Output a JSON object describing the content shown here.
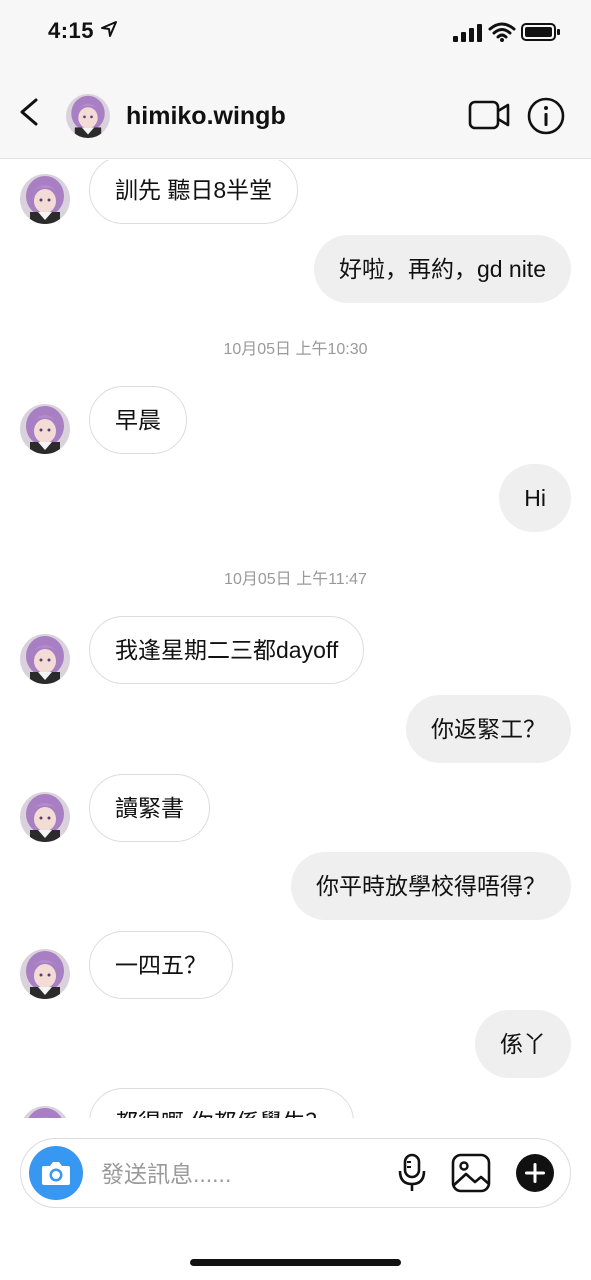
{
  "status_bar": {
    "time": "4:15"
  },
  "header": {
    "username": "himiko.wingb"
  },
  "messages": [
    {
      "from": "them",
      "text": "訓先 聽日8半堂"
    },
    {
      "from": "me",
      "text": "好啦，再約，gd nite"
    },
    {
      "type": "timestamp",
      "text": "10月05日 上午10:30"
    },
    {
      "from": "them",
      "text": "早晨"
    },
    {
      "from": "me",
      "text": "Hi"
    },
    {
      "type": "timestamp",
      "text": "10月05日 上午11:47"
    },
    {
      "from": "them",
      "text": "我逢星期二三都dayoff"
    },
    {
      "from": "me",
      "text": "你返緊工？"
    },
    {
      "from": "them",
      "text": "讀緊書"
    },
    {
      "from": "me",
      "text": "你平時放學校得唔得？"
    },
    {
      "from": "them",
      "text": "一四五？"
    },
    {
      "from": "me",
      "text": "係丫"
    },
    {
      "from": "them",
      "text": "都得嘅 你都係學生？"
    }
  ],
  "composer": {
    "placeholder": "發送訊息......"
  },
  "colors": {
    "accent": "#3897f0",
    "incoming_border": "#dcdcdc",
    "outgoing_bg": "#efefef",
    "timestamp": "#9a9a9a"
  },
  "icons": [
    "back-chevron-icon",
    "video-call-icon",
    "info-icon",
    "camera-icon",
    "microphone-icon",
    "gallery-icon",
    "plus-icon"
  ]
}
